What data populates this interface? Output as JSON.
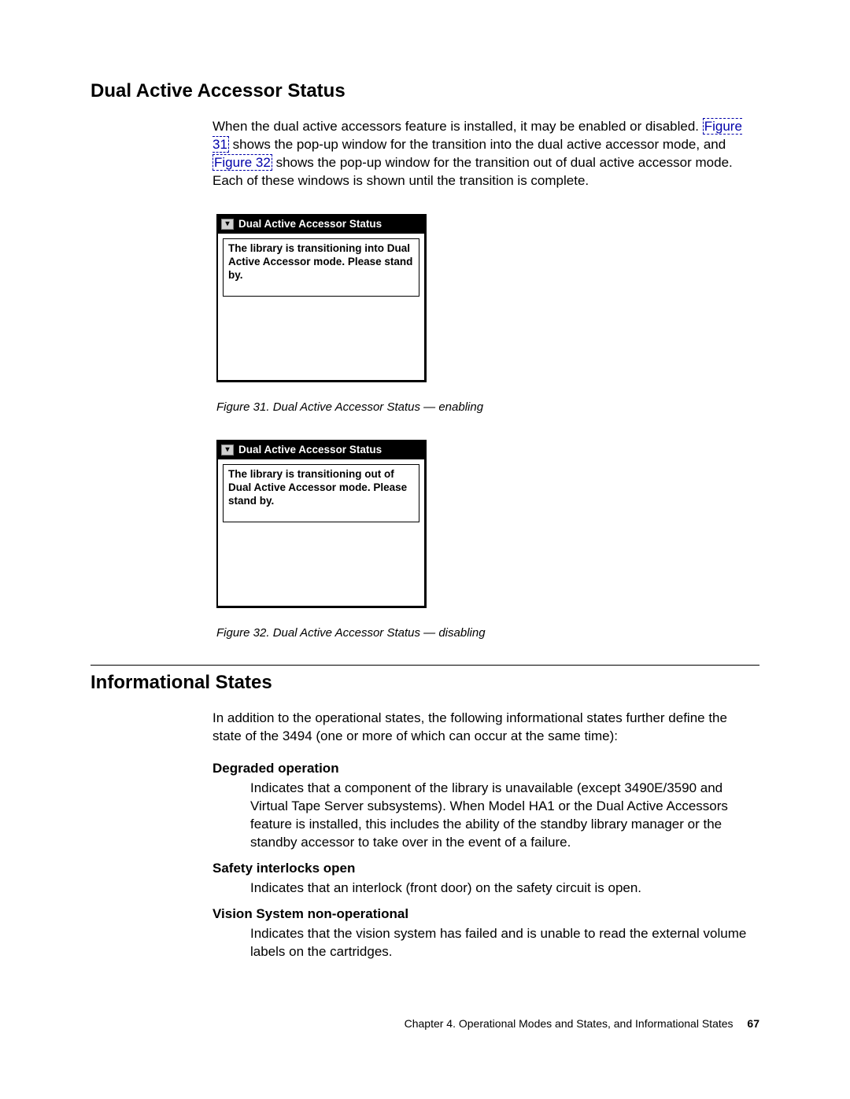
{
  "section1": {
    "heading": "Dual Active Accessor Status",
    "intro_parts": {
      "p1": "When the dual active accessors feature is installed, it may be enabled or disabled. ",
      "link1": "Figure 31",
      "p2": " shows the pop-up window for the transition into the dual active accessor mode, and ",
      "link2": "Figure 32",
      "p3": " shows the pop-up window for the transition out of dual active accessor mode. Each of these windows is shown until the transition is complete."
    },
    "fig31": {
      "title": "Dual Active Accessor Status",
      "body": "The library is transitioning into Dual Active Accessor mode. Please stand by.",
      "caption": "Figure 31. Dual Active Accessor Status — enabling"
    },
    "fig32": {
      "title": "Dual Active Accessor Status",
      "body": "The library is transitioning out of Dual Active Accessor mode. Please stand by.",
      "caption": "Figure 32. Dual Active Accessor Status — disabling"
    }
  },
  "section2": {
    "heading": "Informational States",
    "intro": "In addition to the operational states, the following informational states further define the state of the 3494 (one or more of which can occur at the same time):",
    "items": [
      {
        "term": "Degraded operation",
        "def": "Indicates that a component of the library is unavailable (except 3490E/3590 and Virtual Tape Server subsystems). When Model HA1 or the Dual Active Accessors feature is installed, this includes the ability of the standby library manager or the standby accessor to take over in the event of a failure."
      },
      {
        "term": "Safety interlocks open",
        "def": "Indicates that an interlock (front door) on the safety circuit is open."
      },
      {
        "term": "Vision System non-operational",
        "def": "Indicates that the vision system has failed and is unable to read the external volume labels on the cartridges."
      }
    ]
  },
  "footer": {
    "chapter": "Chapter 4. Operational Modes and States, and Informational States",
    "page": "67"
  }
}
